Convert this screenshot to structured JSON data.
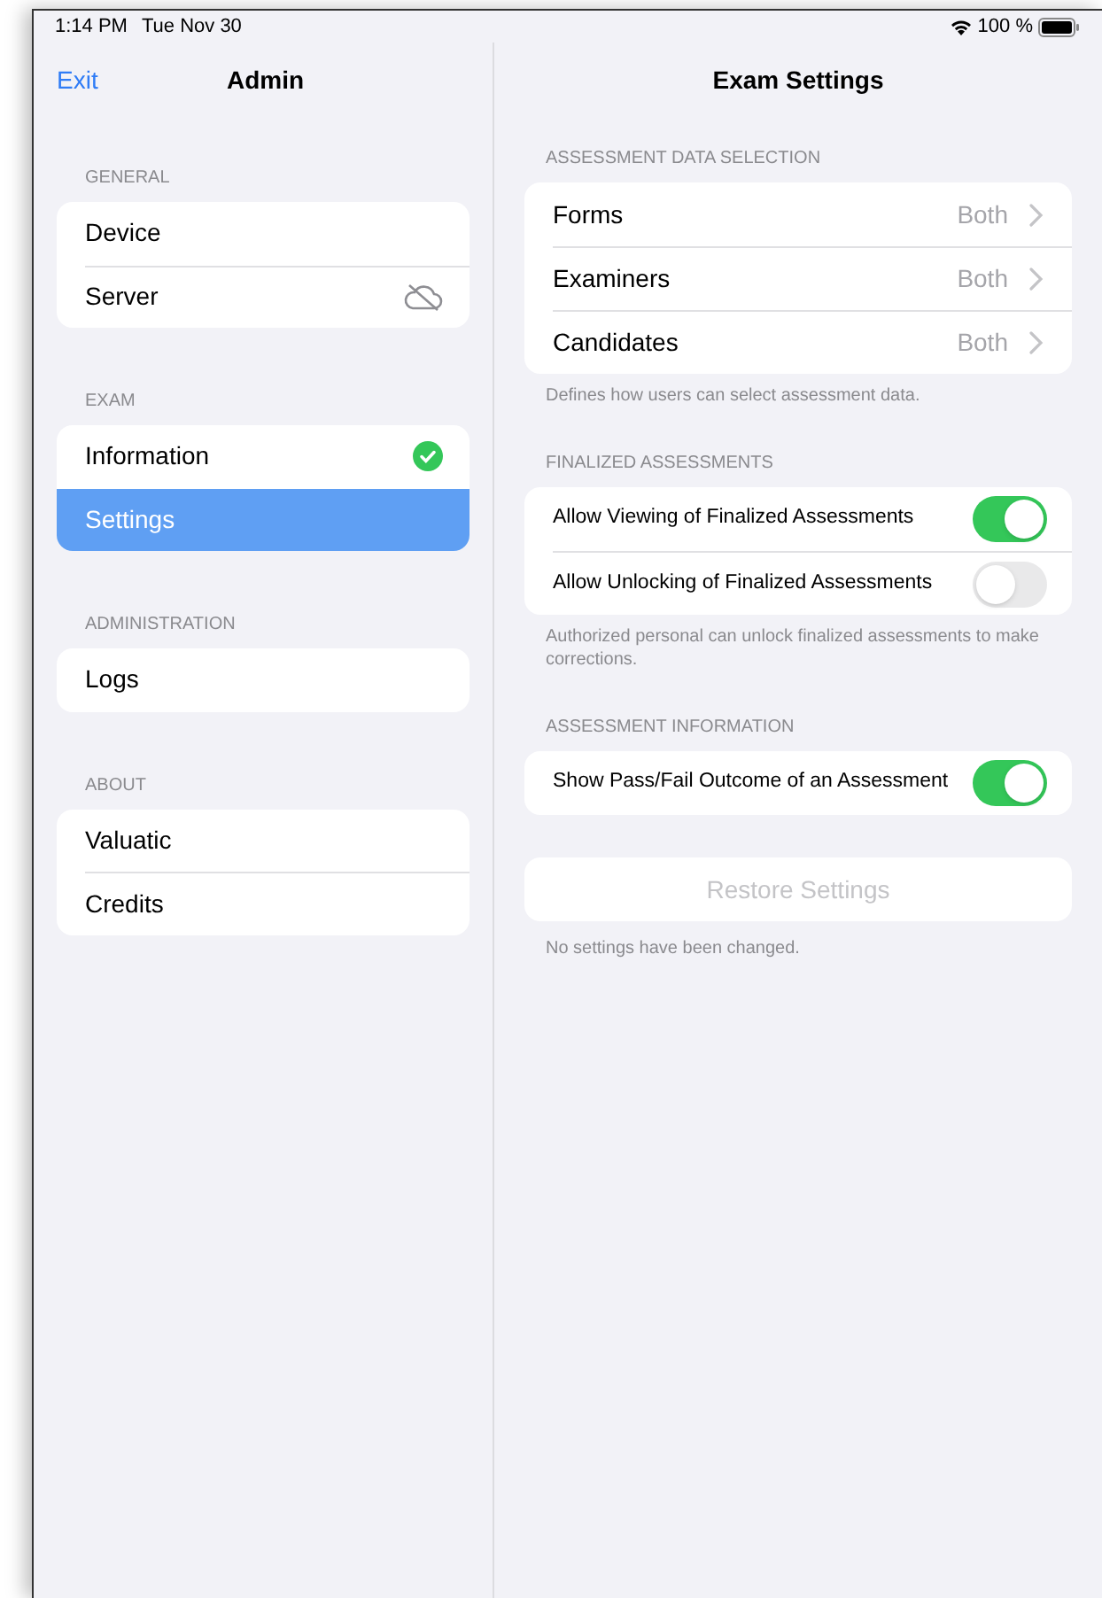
{
  "status_bar": {
    "time": "1:14 PM",
    "date": "Tue Nov 30",
    "battery": "100 %"
  },
  "sidebar": {
    "back_link": "Exit",
    "title": "Admin",
    "sections": [
      {
        "header": "GENERAL",
        "items": [
          {
            "label": "Device",
            "kind": "plain",
            "selected": false
          },
          {
            "label": "Server",
            "kind": "offline",
            "selected": false
          }
        ]
      },
      {
        "header": "EXAM",
        "items": [
          {
            "label": "Information",
            "kind": "done",
            "selected": false
          },
          {
            "label": "Settings",
            "kind": "plain",
            "selected": true
          }
        ]
      },
      {
        "header": "ADMINISTRATION",
        "items": [
          {
            "label": "Logs",
            "kind": "plain",
            "selected": false
          }
        ]
      },
      {
        "header": "ABOUT",
        "items": [
          {
            "label": "Valuatic",
            "kind": "plain",
            "selected": false
          },
          {
            "label": "Credits",
            "kind": "plain",
            "selected": false
          }
        ]
      }
    ]
  },
  "detail": {
    "title": "Exam Settings",
    "sections": [
      {
        "header": "ASSESSMENT DATA SELECTION",
        "rows": [
          {
            "kind": "picker",
            "label": "Forms",
            "value": "Both"
          },
          {
            "kind": "picker",
            "label": "Examiners",
            "value": "Both"
          },
          {
            "kind": "picker",
            "label": "Candidates",
            "value": "Both"
          }
        ],
        "footer": "Defines how users can select assessment data."
      },
      {
        "header": "FINALIZED ASSESSMENTS",
        "rows": [
          {
            "kind": "toggle",
            "label": "Allow Viewing of Finalized Assessments",
            "on": true
          },
          {
            "kind": "toggle",
            "label": "Allow Unlocking of Finalized Assessments",
            "on": false
          }
        ],
        "footer": "Authorized personal can unlock finalized assessments to make corrections."
      },
      {
        "header": "ASSESSMENT INFORMATION",
        "rows": [
          {
            "kind": "toggle",
            "label": "Show Pass/Fail Outcome of an Assessment",
            "on": true
          }
        ]
      }
    ],
    "restore_button": {
      "label": "Restore Settings",
      "disabled": true
    },
    "restore_footer": "No settings have been changed."
  }
}
